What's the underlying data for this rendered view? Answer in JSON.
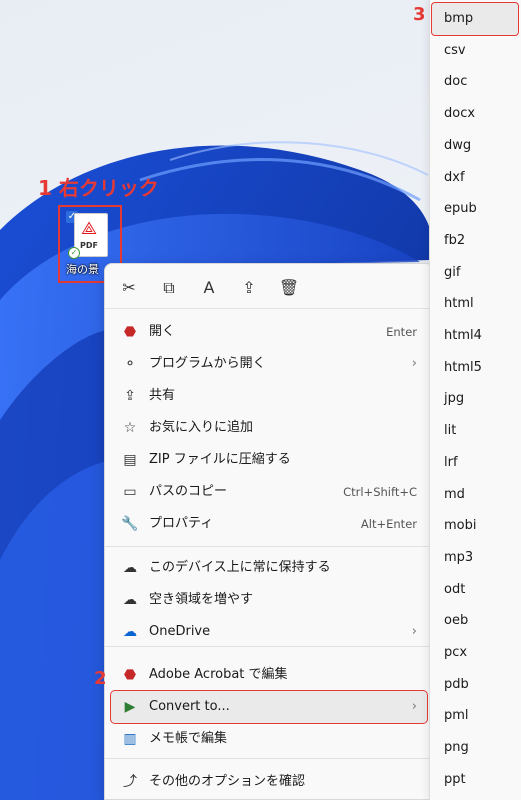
{
  "annotations": {
    "step1": "1 右クリック",
    "step2": "2",
    "step3": "3"
  },
  "desktop_file": {
    "name": "海の景",
    "icon_label": "PDF"
  },
  "toolbar": [
    {
      "name": "cut-icon",
      "glyph": "✂"
    },
    {
      "name": "copy-icon",
      "glyph": "⧉"
    },
    {
      "name": "rename-icon",
      "glyph": "A"
    },
    {
      "name": "share-icon",
      "glyph": "⇪"
    },
    {
      "name": "delete-icon",
      "glyph": "🗑"
    }
  ],
  "menu": [
    {
      "label": "開く",
      "shortcut": "Enter",
      "icon": "acrobat-icon",
      "glyph": "⬣",
      "color": "#c62828"
    },
    {
      "label": "プログラムから開く",
      "arrow": "›",
      "icon": "open-with-icon",
      "glyph": "⚬"
    },
    {
      "label": "共有",
      "icon": "share-icon",
      "glyph": "⇪"
    },
    {
      "label": "お気に入りに追加",
      "icon": "star-icon",
      "glyph": "☆"
    },
    {
      "label": "ZIP ファイルに圧縮する",
      "icon": "zip-icon",
      "glyph": "▤"
    },
    {
      "label": "パスのコピー",
      "shortcut": "Ctrl+Shift+C",
      "icon": "copy-path-icon",
      "glyph": "▭"
    },
    {
      "label": "プロパティ",
      "shortcut": "Alt+Enter",
      "icon": "wrench-icon",
      "glyph": "🔧"
    },
    {
      "label": "このデバイス上に常に保持する",
      "icon": "cloud-keep-icon",
      "glyph": "☁"
    },
    {
      "label": "空き領域を増やす",
      "icon": "cloud-icon",
      "glyph": "☁"
    },
    {
      "label": "OneDrive",
      "arrow": "›",
      "icon": "onedrive-icon",
      "glyph": "☁",
      "color": "#0a64d2"
    },
    {
      "label": "Adobe Acrobat で編集",
      "icon": "acrobat-edit-icon",
      "glyph": "⬣",
      "color": "#c62828"
    },
    {
      "label": "Convert to...",
      "arrow": "›",
      "icon": "convert-icon",
      "glyph": "▶",
      "color": "#2e7d32"
    },
    {
      "label": "メモ帳で編集",
      "icon": "notepad-icon",
      "glyph": "▥",
      "color": "#1565c0"
    },
    {
      "label": "その他のオプションを確認",
      "icon": "more-options-icon",
      "glyph": "⤴"
    }
  ],
  "submenu": [
    "bmp",
    "csv",
    "doc",
    "docx",
    "dwg",
    "dxf",
    "epub",
    "fb2",
    "gif",
    "html",
    "html4",
    "html5",
    "jpg",
    "lit",
    "lrf",
    "md",
    "mobi",
    "mp3",
    "odt",
    "oeb",
    "pcx",
    "pdb",
    "pml",
    "png",
    "ppt"
  ]
}
